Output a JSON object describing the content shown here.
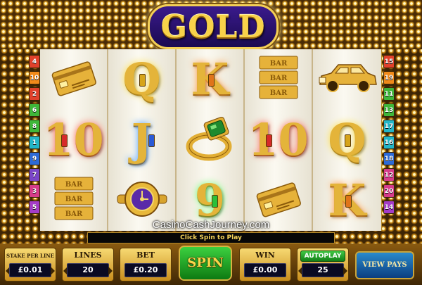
{
  "game": {
    "title": "GOLD"
  },
  "watermark": "CasinoCashJourney.com",
  "message": "Click Spin to Play",
  "left_lines": [
    {
      "n": "4",
      "color": "#e0412b"
    },
    {
      "n": "10",
      "color": "#f08a1a"
    },
    {
      "n": "2",
      "color": "#e0412b"
    },
    {
      "n": "6",
      "color": "#3fb63a"
    },
    {
      "n": "8",
      "color": "#3fb63a"
    },
    {
      "n": "1",
      "color": "#23b6c8"
    },
    {
      "n": "9",
      "color": "#2d6ad6"
    },
    {
      "n": "7",
      "color": "#7a46c8"
    },
    {
      "n": "3",
      "color": "#d63c8a"
    },
    {
      "n": "5",
      "color": "#a43cc8"
    }
  ],
  "right_lines": [
    {
      "n": "15",
      "color": "#e0412b"
    },
    {
      "n": "19",
      "color": "#f08a1a"
    },
    {
      "n": "11",
      "color": "#3fb63a"
    },
    {
      "n": "13",
      "color": "#3fb63a"
    },
    {
      "n": "17",
      "color": "#23b6c8"
    },
    {
      "n": "16",
      "color": "#23b6c8"
    },
    {
      "n": "18",
      "color": "#2d6ad6"
    },
    {
      "n": "12",
      "color": "#d63c8a"
    },
    {
      "n": "20",
      "color": "#d63c8a"
    },
    {
      "n": "14",
      "color": "#a43cc8"
    }
  ],
  "reels": [
    [
      {
        "type": "card-icon"
      },
      {
        "type": "letter",
        "text": "10",
        "gem": "#d62a2a",
        "glow": "red"
      },
      {
        "type": "bars-icon",
        "text": "BAR"
      }
    ],
    [
      {
        "type": "letter",
        "text": "Q",
        "gem": "#d6a41a",
        "glow": "yellow"
      },
      {
        "type": "letter",
        "text": "J",
        "gem": "#2a5ad6",
        "glow": "blue"
      },
      {
        "type": "watch-icon"
      }
    ],
    [
      {
        "type": "letter",
        "text": "K",
        "gem": "#e0741a",
        "glow": "orange"
      },
      {
        "type": "ring-icon"
      },
      {
        "type": "letter",
        "text": "9",
        "gem": "#2ac03a",
        "glow": "green"
      }
    ],
    [
      {
        "type": "bars-icon",
        "text": "BAR"
      },
      {
        "type": "letter",
        "text": "10",
        "gem": "#d62a2a",
        "glow": "red"
      },
      {
        "type": "card-icon"
      }
    ],
    [
      {
        "type": "car-icon"
      },
      {
        "type": "letter",
        "text": "Q",
        "gem": "#d6a41a",
        "glow": "yellow"
      },
      {
        "type": "letter",
        "text": "K",
        "gem": "#e0741a",
        "glow": "orange"
      }
    ]
  ],
  "controls": {
    "stake": {
      "label": "STAKE PER LINE",
      "value": "£0.01"
    },
    "lines": {
      "label": "LINES",
      "value": "20"
    },
    "bet": {
      "label": "BET",
      "value": "£0.20"
    },
    "spin": "SPIN",
    "win": {
      "label": "WIN",
      "value": "£0.00"
    },
    "autoplay": {
      "label": "AUTOPLAY",
      "value": "25"
    },
    "view_pays": "VIEW PAYS"
  }
}
